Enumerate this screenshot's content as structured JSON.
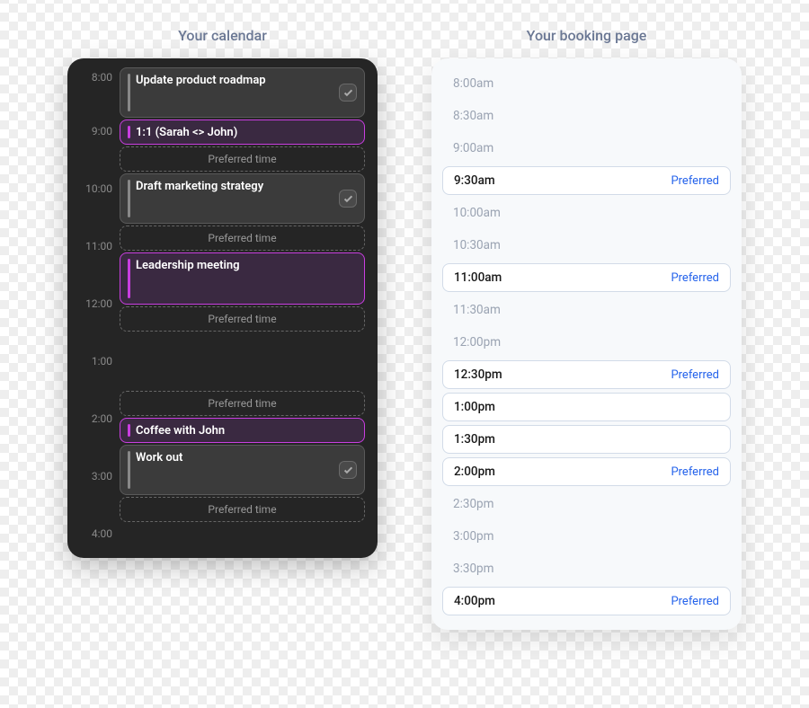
{
  "titles": {
    "calendar": "Your calendar",
    "booking": "Your booking page"
  },
  "calendar": {
    "hours": [
      "8:00",
      "9:00",
      "10:00",
      "11:00",
      "12:00",
      "1:00",
      "2:00",
      "3:00",
      "4:00"
    ],
    "preferred_label": "Preferred time",
    "events": {
      "e1": "Update product roadmap",
      "e2": "1:1 (Sarah <> John)",
      "e3": "Draft marketing strategy",
      "e4": "Leadership meeting",
      "e5": "Coffee with John",
      "e6": "Work out"
    }
  },
  "booking": {
    "preferred_label": "Preferred",
    "slots": [
      {
        "time": "8:00am",
        "available": false,
        "preferred": false
      },
      {
        "time": "8:30am",
        "available": false,
        "preferred": false
      },
      {
        "time": "9:00am",
        "available": false,
        "preferred": false
      },
      {
        "time": "9:30am",
        "available": true,
        "preferred": true
      },
      {
        "time": "10:00am",
        "available": false,
        "preferred": false
      },
      {
        "time": "10:30am",
        "available": false,
        "preferred": false
      },
      {
        "time": "11:00am",
        "available": true,
        "preferred": true
      },
      {
        "time": "11:30am",
        "available": false,
        "preferred": false
      },
      {
        "time": "12:00pm",
        "available": false,
        "preferred": false
      },
      {
        "time": "12:30pm",
        "available": true,
        "preferred": true
      },
      {
        "time": "1:00pm",
        "available": true,
        "preferred": false
      },
      {
        "time": "1:30pm",
        "available": true,
        "preferred": false
      },
      {
        "time": "2:00pm",
        "available": true,
        "preferred": true
      },
      {
        "time": "2:30pm",
        "available": false,
        "preferred": false
      },
      {
        "time": "3:00pm",
        "available": false,
        "preferred": false
      },
      {
        "time": "3:30pm",
        "available": false,
        "preferred": false
      },
      {
        "time": "4:00pm",
        "available": true,
        "preferred": true
      }
    ]
  }
}
